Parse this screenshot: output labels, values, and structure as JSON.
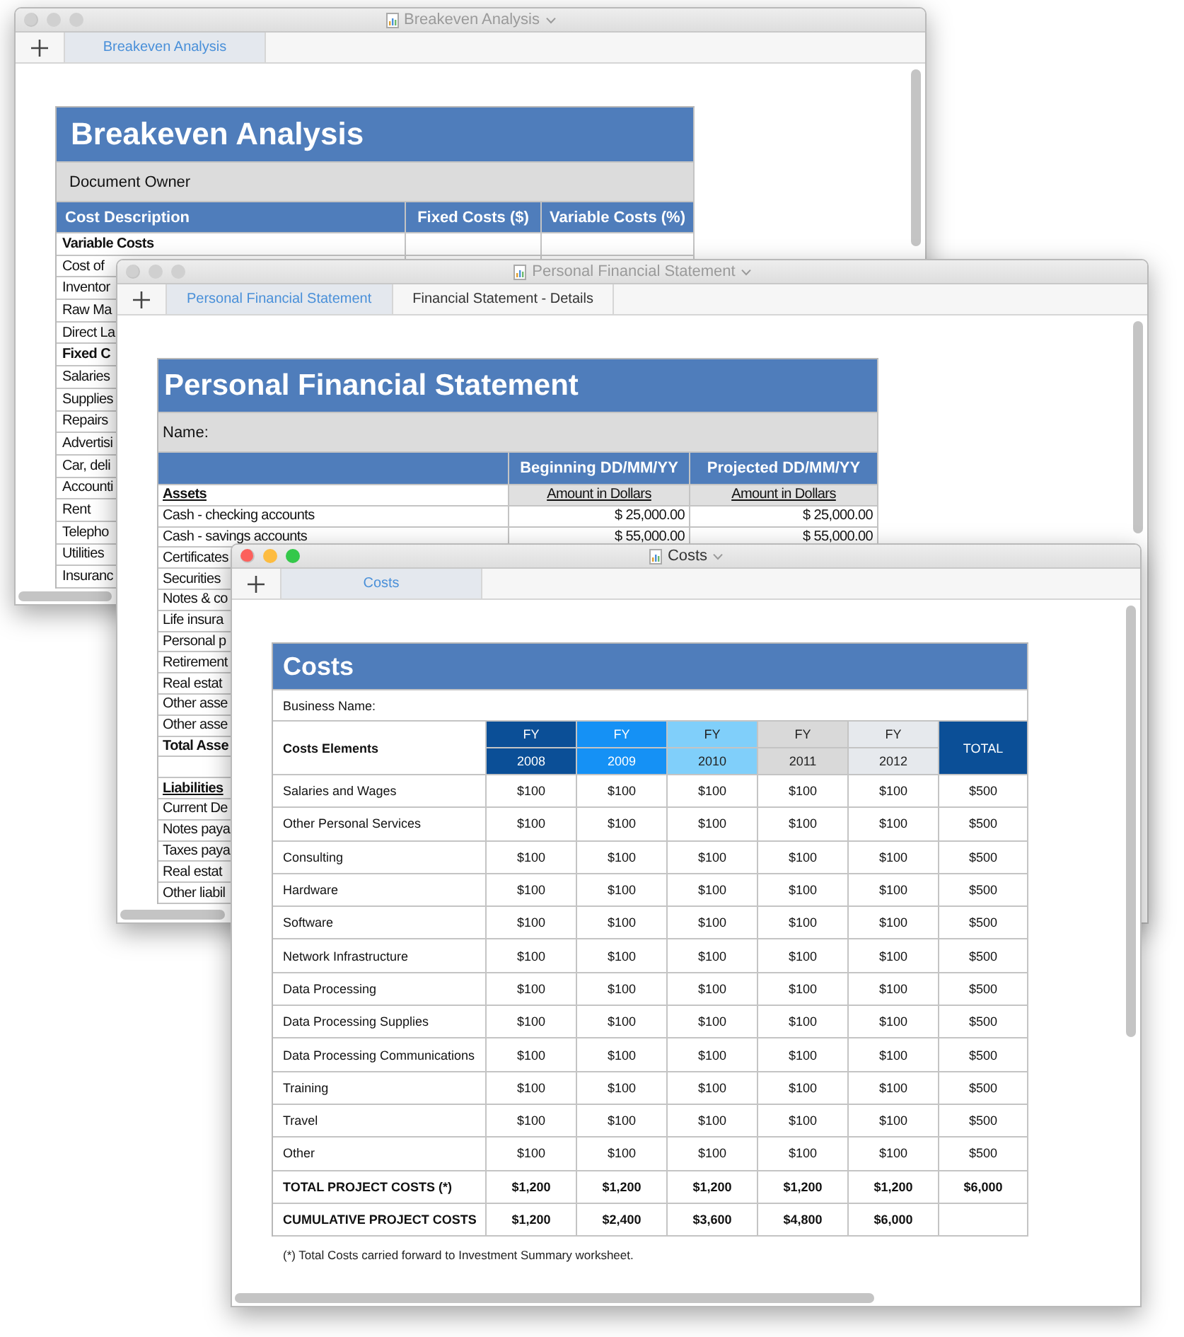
{
  "breakeven_window": {
    "title": "Breakeven Analysis",
    "active": false,
    "tabs": [
      {
        "label": "Breakeven Analysis",
        "selected": true
      }
    ],
    "sheet": {
      "title": "Breakeven Analysis",
      "owner_label": "Document Owner",
      "columns": [
        "Cost Description",
        "Fixed Costs ($)",
        "Variable Costs (%)"
      ],
      "rows": [
        {
          "kind": "section",
          "label": "Variable Costs"
        },
        {
          "kind": "item",
          "label": "Cost of"
        },
        {
          "kind": "item",
          "label": "Inventor"
        },
        {
          "kind": "item",
          "label": "Raw Ma"
        },
        {
          "kind": "item",
          "label": "Direct La"
        },
        {
          "kind": "section",
          "label": "Fixed C"
        },
        {
          "kind": "item",
          "label": "Salaries"
        },
        {
          "kind": "item",
          "label": "Supplies"
        },
        {
          "kind": "item",
          "label": "Repairs"
        },
        {
          "kind": "item",
          "label": "Advertisi"
        },
        {
          "kind": "item",
          "label": "Car, deli"
        },
        {
          "kind": "item",
          "label": "Accounti"
        },
        {
          "kind": "item",
          "label": "Rent"
        },
        {
          "kind": "item",
          "label": "Telepho"
        },
        {
          "kind": "item",
          "label": "Utilities"
        },
        {
          "kind": "item",
          "label": "Insuranc"
        }
      ]
    }
  },
  "statement_window": {
    "title": "Personal Financial Statement",
    "active": false,
    "tabs": [
      {
        "label": "Personal Financial Statement",
        "selected": true
      },
      {
        "label": "Financial Statement - Details",
        "selected": false
      }
    ],
    "sheet": {
      "title": "Personal Financial Statement",
      "name_label": "Name:",
      "columns": [
        "Beginning DD/MM/YY",
        "Projected DD/MM/YY"
      ],
      "rows": [
        {
          "kind": "section",
          "label": "Assets",
          "values": [
            "Amount in Dollars",
            "Amount in Dollars"
          ]
        },
        {
          "kind": "item",
          "label": "Cash - checking accounts",
          "values": [
            "$ 25,000.00",
            "$ 25,000.00"
          ]
        },
        {
          "kind": "item",
          "label": "Cash - savings accounts",
          "values": [
            "$ 55,000.00",
            "$ 55,000.00"
          ]
        },
        {
          "kind": "item",
          "label": "Certificates"
        },
        {
          "kind": "item",
          "label": "Securities"
        },
        {
          "kind": "item",
          "label": "Notes & co"
        },
        {
          "kind": "item",
          "label": "Life insura"
        },
        {
          "kind": "item",
          "label": "Personal p"
        },
        {
          "kind": "item",
          "label": "Retirement"
        },
        {
          "kind": "item",
          "label": "Real estat"
        },
        {
          "kind": "item",
          "label": "Other asse"
        },
        {
          "kind": "item",
          "label": "Other asse"
        },
        {
          "kind": "total",
          "label": "Total Asse"
        },
        {
          "kind": "spacer"
        },
        {
          "kind": "section",
          "label": "Liabilities"
        },
        {
          "kind": "item",
          "label": "Current De"
        },
        {
          "kind": "item",
          "label": "Notes paya"
        },
        {
          "kind": "item",
          "label": "Taxes paya"
        },
        {
          "kind": "item",
          "label": "Real estat"
        },
        {
          "kind": "item",
          "label": "Other liabil"
        }
      ]
    }
  },
  "costs_window": {
    "title": "Costs",
    "active": true,
    "tabs": [
      {
        "label": "Costs",
        "selected": true
      }
    ],
    "sheet": {
      "title": "Costs",
      "business_label": "Business Name:",
      "label_header": "Costs Elements",
      "years": [
        {
          "prefix": "FY",
          "year": "2008",
          "color": "#0b4f97"
        },
        {
          "prefix": "FY",
          "year": "2009",
          "color": "#1591f5"
        },
        {
          "prefix": "FY",
          "year": "2010",
          "color": "#80cffa"
        },
        {
          "prefix": "FY",
          "year": "2011",
          "color": "#d9d9d9"
        },
        {
          "prefix": "FY",
          "year": "2012",
          "color": "#e6e9ed"
        }
      ],
      "total_header": "TOTAL",
      "rows": [
        {
          "kind": "item",
          "label": "Salaries and Wages",
          "values": [
            "$100",
            "$100",
            "$100",
            "$100",
            "$100",
            "$500"
          ]
        },
        {
          "kind": "item",
          "label": "Other Personal Services",
          "values": [
            "$100",
            "$100",
            "$100",
            "$100",
            "$100",
            "$500"
          ]
        },
        {
          "kind": "item",
          "label": "Consulting",
          "values": [
            "$100",
            "$100",
            "$100",
            "$100",
            "$100",
            "$500"
          ]
        },
        {
          "kind": "item",
          "label": "Hardware",
          "values": [
            "$100",
            "$100",
            "$100",
            "$100",
            "$100",
            "$500"
          ]
        },
        {
          "kind": "item",
          "label": "Software",
          "values": [
            "$100",
            "$100",
            "$100",
            "$100",
            "$100",
            "$500"
          ]
        },
        {
          "kind": "item",
          "label": "Network Infrastructure",
          "values": [
            "$100",
            "$100",
            "$100",
            "$100",
            "$100",
            "$500"
          ]
        },
        {
          "kind": "item",
          "label": "Data Processing",
          "values": [
            "$100",
            "$100",
            "$100",
            "$100",
            "$100",
            "$500"
          ]
        },
        {
          "kind": "item",
          "label": "Data Processing Supplies",
          "values": [
            "$100",
            "$100",
            "$100",
            "$100",
            "$100",
            "$500"
          ]
        },
        {
          "kind": "item",
          "label": "Data Processing Communications",
          "values": [
            "$100",
            "$100",
            "$100",
            "$100",
            "$100",
            "$500"
          ]
        },
        {
          "kind": "item",
          "label": "Training",
          "values": [
            "$100",
            "$100",
            "$100",
            "$100",
            "$100",
            "$500"
          ]
        },
        {
          "kind": "item",
          "label": "Travel",
          "values": [
            "$100",
            "$100",
            "$100",
            "$100",
            "$100",
            "$500"
          ]
        },
        {
          "kind": "item",
          "label": "Other",
          "values": [
            "$100",
            "$100",
            "$100",
            "$100",
            "$100",
            "$500"
          ]
        },
        {
          "kind": "total",
          "label": "TOTAL PROJECT COSTS  (*)",
          "values": [
            "$1,200",
            "$1,200",
            "$1,200",
            "$1,200",
            "$1,200",
            "$6,000"
          ]
        },
        {
          "kind": "total",
          "label": "CUMULATIVE PROJECT COSTS",
          "values": [
            "$1,200",
            "$2,400",
            "$3,600",
            "$4,800",
            "$6,000"
          ]
        }
      ],
      "footnote": "(*) Total Costs carried forward to Investment Summary worksheet."
    }
  }
}
